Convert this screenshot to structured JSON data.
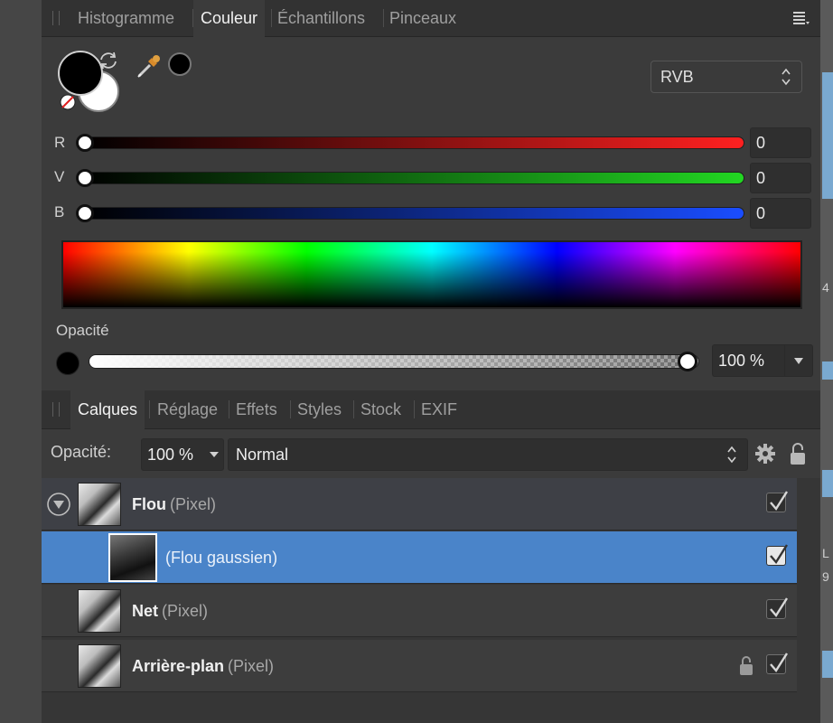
{
  "color_panel": {
    "tabs": [
      "Histogramme",
      "Couleur",
      "Échantillons",
      "Pinceaux"
    ],
    "active_tab": "Couleur",
    "mode": "RVB",
    "channels": [
      {
        "label": "R",
        "value": "0",
        "color": "#ff2020"
      },
      {
        "label": "V",
        "value": "0",
        "color": "#22d622"
      },
      {
        "label": "B",
        "value": "0",
        "color": "#1a4dff"
      }
    ],
    "opacity_label": "Opacité",
    "opacity_value": "100 %",
    "opacity_fraction": 1.0,
    "primary_color": "#000000",
    "secondary_color": "#ffffff"
  },
  "layers_panel": {
    "tabs": [
      "Calques",
      "Réglage",
      "Effets",
      "Styles",
      "Stock",
      "EXIF"
    ],
    "active_tab": "Calques",
    "opacity_label": "Opacité:",
    "opacity_value": "100 %",
    "blend_mode": "Normal",
    "layers": [
      {
        "name": "Flou",
        "type": "(Pixel)",
        "checked": true,
        "expanded": true
      },
      {
        "name": "(Flou gaussien)",
        "type": "",
        "checked": true,
        "child": true,
        "selected": true
      },
      {
        "name": "Net",
        "type": "(Pixel)",
        "checked": true
      },
      {
        "name": "Arrière-plan",
        "type": "(Pixel)",
        "checked": true,
        "locked": true
      }
    ]
  },
  "right_edge": {
    "chars": [
      "4",
      "L",
      "9"
    ]
  }
}
